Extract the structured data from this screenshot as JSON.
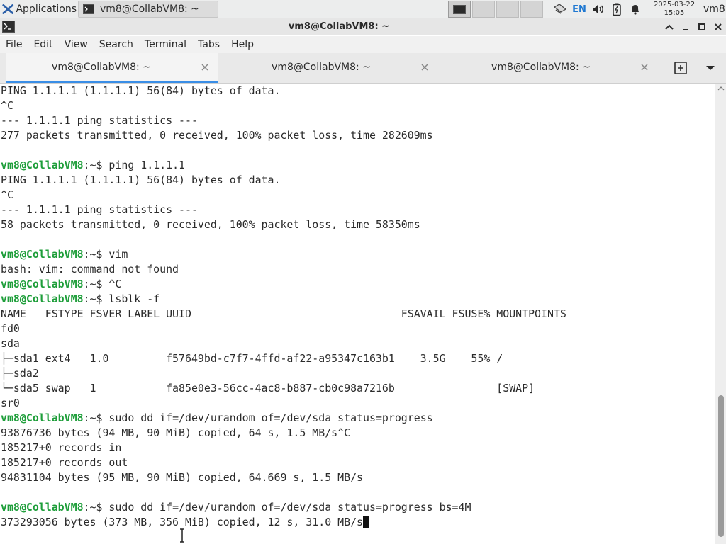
{
  "panel": {
    "apps_label": "Applications",
    "task_title": "vm8@CollabVM8: ~",
    "language": "EN",
    "clock_date": "2025-03-22",
    "clock_time": "15:05",
    "user": "vm8"
  },
  "window": {
    "title": "vm8@CollabVM8: ~"
  },
  "menu": [
    "File",
    "Edit",
    "View",
    "Search",
    "Terminal",
    "Tabs",
    "Help"
  ],
  "tabs": [
    {
      "label": "vm8@CollabVM8: ~",
      "active": true
    },
    {
      "label": "vm8@CollabVM8: ~",
      "active": false
    },
    {
      "label": "vm8@CollabVM8: ~",
      "active": false
    }
  ],
  "terminal": {
    "lines": [
      {
        "text": "PING 1.1.1.1 (1.1.1.1) 56(84) bytes of data."
      },
      {
        "text": "^C"
      },
      {
        "text": "--- 1.1.1.1 ping statistics ---"
      },
      {
        "text": "277 packets transmitted, 0 received, 100% packet loss, time 282609ms"
      },
      {
        "text": ""
      },
      {
        "prompt": "vm8@CollabVM8",
        "path": ":~$ ",
        "cmd": "ping 1.1.1.1"
      },
      {
        "text": "PING 1.1.1.1 (1.1.1.1) 56(84) bytes of data."
      },
      {
        "text": "^C"
      },
      {
        "text": "--- 1.1.1.1 ping statistics ---"
      },
      {
        "text": "58 packets transmitted, 0 received, 100% packet loss, time 58350ms"
      },
      {
        "text": ""
      },
      {
        "prompt": "vm8@CollabVM8",
        "path": ":~$ ",
        "cmd": "vim"
      },
      {
        "text": "bash: vim: command not found"
      },
      {
        "prompt": "vm8@CollabVM8",
        "path": ":~$ ",
        "cmd": "^C"
      },
      {
        "prompt": "vm8@CollabVM8",
        "path": ":~$ ",
        "cmd": "lsblk -f"
      },
      {
        "text": "NAME   FSTYPE FSVER LABEL UUID                                 FSAVAIL FSUSE% MOUNTPOINTS"
      },
      {
        "text": "fd0"
      },
      {
        "text": "sda"
      },
      {
        "text": "├─sda1 ext4   1.0         f57649bd-c7f7-4ffd-af22-a95347c163b1    3.5G    55% /"
      },
      {
        "text": "├─sda2"
      },
      {
        "text": "└─sda5 swap   1           fa85e0e3-56cc-4ac8-b887-cb0c98a7216b                [SWAP]"
      },
      {
        "text": "sr0"
      },
      {
        "prompt": "vm8@CollabVM8",
        "path": ":~$ ",
        "cmd": "sudo dd if=/dev/urandom of=/dev/sda status=progress"
      },
      {
        "text": "93876736 bytes (94 MB, 90 MiB) copied, 64 s, 1.5 MB/s^C"
      },
      {
        "text": "185217+0 records in"
      },
      {
        "text": "185217+0 records out"
      },
      {
        "text": "94831104 bytes (95 MB, 90 MiB) copied, 64.669 s, 1.5 MB/s"
      },
      {
        "text": ""
      },
      {
        "prompt": "vm8@CollabVM8",
        "path": ":~$ ",
        "cmd": "sudo dd if=/dev/urandom of=/dev/sda status=progress bs=4M"
      },
      {
        "text": "373293056 bytes (373 MB, 356 MiB) copied, 12 s, 31.0 MB/s",
        "cursor": true
      }
    ]
  },
  "colors": {
    "prompt_user": "#1e9e3a",
    "tab_accent": "#3a8ee6",
    "language_indicator": "#1f78d1"
  }
}
